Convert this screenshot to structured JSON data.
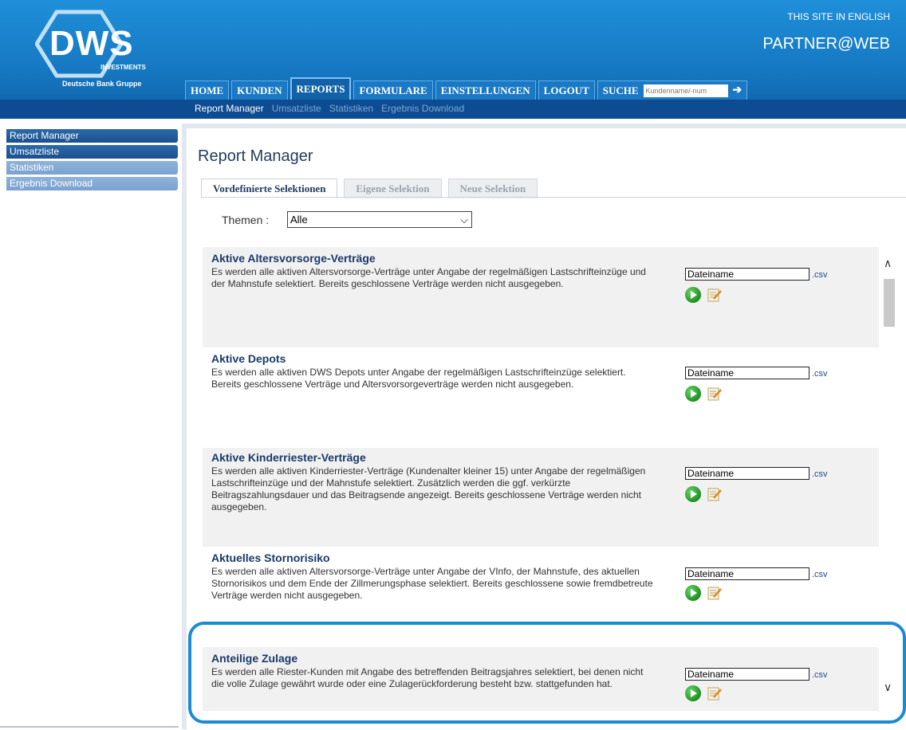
{
  "header": {
    "logo_text": "DWS",
    "logo_sub": "INVESTMENTS",
    "logo_group": "Deutsche Bank Gruppe",
    "lang_link": "THIS SITE IN ENGLISH",
    "partner": "PARTNER@WEB"
  },
  "nav": {
    "tabs": [
      "HOME",
      "KUNDEN",
      "REPORTS",
      "FORMULARE",
      "EINSTELLUNGEN",
      "LOGOUT"
    ],
    "active_tab": "REPORTS",
    "search_label": "SUCHE",
    "search_placeholder": "Kundenname/-num"
  },
  "subnav": {
    "items": [
      "Report Manager",
      "Umsatzliste",
      "Statistiken",
      "Ergebnis Download"
    ],
    "active": "Report Manager"
  },
  "sidebar": {
    "items": [
      {
        "label": "Report Manager",
        "style": "dark"
      },
      {
        "label": "Umsatzliste",
        "style": "dark"
      },
      {
        "label": "Statistiken",
        "style": "light"
      },
      {
        "label": "Ergebnis Download",
        "style": "light"
      }
    ]
  },
  "main": {
    "title": "Report Manager",
    "tabs": [
      "Vordefinierte Selektionen",
      "Eigene Selektion",
      "Neue Selektion"
    ],
    "active_tab": "Vordefinierte Selektionen",
    "themen_label": "Themen :",
    "themen_value": "Alle"
  },
  "reports": [
    {
      "title": "Aktive Altersvorsorge-Verträge",
      "desc": "Es werden alle aktiven Altersvorsorge-Verträge unter Angabe der regelmäßigen Lastschrifteinzüge und der Mahnstufe selektiert. Bereits geschlossene Verträge werden nicht ausgegeben.",
      "file_value": "Dateiname",
      "ext": ".csv"
    },
    {
      "title": "Aktive Depots",
      "desc": "Es werden alle aktiven DWS Depots unter Angabe der regelmäßigen Lastschrifteinzüge selektiert. Bereits geschlossene Verträge und Altersvorsorgeverträge werden nicht ausgegeben.",
      "file_value": "Dateiname",
      "ext": ".csv"
    },
    {
      "title": "Aktive Kinderriester-Verträge",
      "desc": "Es werden alle aktiven Kinderriester-Verträge (Kundenalter kleiner 15) unter Angabe der regelmäßigen Lastschrifteinzüge und der Mahnstufe selektiert. Zusätzlich werden die ggf. verkürzte Beitragszahlungsdauer und das Beitragsende angezeigt. Bereits geschlossene Verträge werden nicht ausgegeben.",
      "file_value": "Dateiname",
      "ext": ".csv"
    },
    {
      "title": "Aktuelles Stornorisiko",
      "desc": "Es werden alle aktiven Altersvorsorge-Verträge unter Angabe der VInfo, der Mahnstufe, des aktuellen Stornorisikos und dem Ende der Zillmerungsphase selektiert. Bereits geschlossene sowie fremdbetreute Verträge werden nicht ausgegeben.",
      "file_value": "Dateiname",
      "ext": ".csv"
    },
    {
      "title": "Anteilige Zulage",
      "desc": "Es werden alle Riester-Kunden mit Angabe des betreffenden Beitragsjahres selektiert, bei denen nicht die volle Zulage gewährt wurde oder eine Zulagerückforderung besteht bzw. stattgefunden hat.",
      "file_value": "Dateiname",
      "ext": ".csv"
    }
  ],
  "colors": {
    "header_blue": "#1678c2",
    "subnav_blue": "#0d4c92",
    "highlight": "#1a8bd0",
    "run_green": "#1e8f1e"
  },
  "icons": {
    "run": "play-circle-icon",
    "edit": "edit-note-icon",
    "search_go": "arrow-right-icon",
    "select": "chevron-down-icon",
    "scroll_up": "chevron-up-icon",
    "scroll_down": "chevron-down-icon"
  }
}
